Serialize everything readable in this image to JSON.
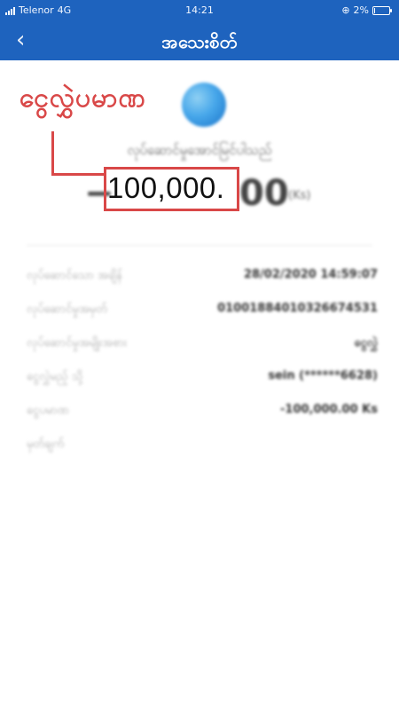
{
  "status_bar": {
    "carrier": "Telenor",
    "network": "4G",
    "time": "14:21",
    "battery": "2%"
  },
  "header": {
    "title": "အသေးစိတ်",
    "back_icon": "chevron-left-icon"
  },
  "summary": {
    "status_text": "လုပ်ဆောင်မှုအောင်မြင်ပါသည်",
    "amount_sign": "−",
    "amount_highlight": "100,000.",
    "amount_cents": "00",
    "unit": "(Ks)"
  },
  "annotation": {
    "label": "ငွေလွှဲပမာဏ",
    "color": "#D94848"
  },
  "details": [
    {
      "label": "လုပ်ဆောင်သော အချိန်",
      "value": "28/02/2020 14:59:07"
    },
    {
      "label": "လုပ်ဆောင်မှုအမှတ်",
      "value": "01001884010326674531"
    },
    {
      "label": "လုပ်ဆောင်မှုအမျိုးအစား",
      "value": "ငွေလွှဲ"
    },
    {
      "label": "ငွေလွှဲမည့် သို့",
      "value": "sein (******6628)"
    },
    {
      "label": "ငွေပမာဏ",
      "value": "-100,000.00 Ks"
    },
    {
      "label": "မှတ်ချက်",
      "value": ""
    }
  ],
  "colors": {
    "header_bg": "#1E63BE",
    "accent_red": "#D94848"
  }
}
